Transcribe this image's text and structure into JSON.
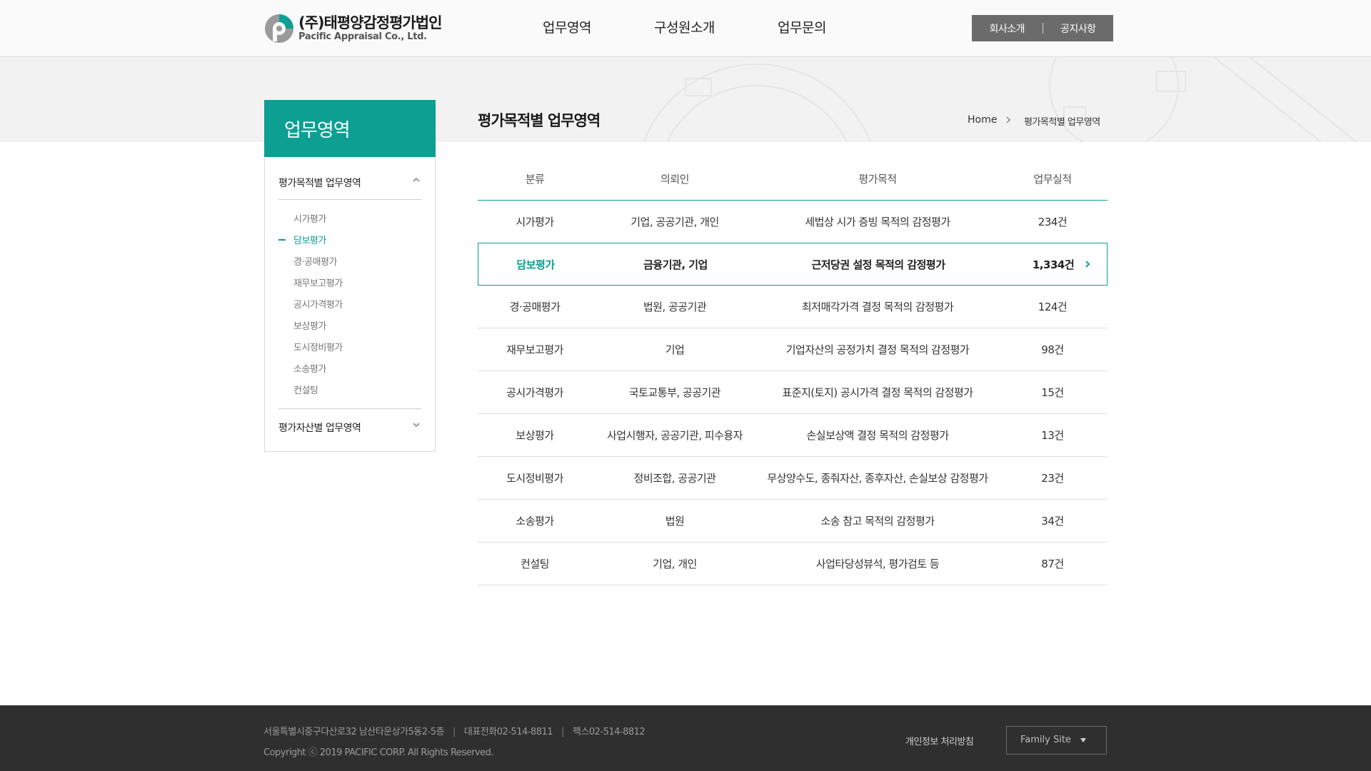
{
  "header": {
    "logo_name": "(주)태평양감정평가법인",
    "logo_name_en": "Pacific Appraisal Co., Ltd.",
    "nav": [
      "업무영역",
      "구성원소개",
      "업무문의"
    ],
    "top_links": [
      "회사소개",
      "공지사항"
    ]
  },
  "sidebar": {
    "title": "업무영역",
    "groups": [
      {
        "label": "평가목적별 업무영역",
        "expanded": true,
        "items": [
          "시가평가",
          "담보평가",
          "경·공매평가",
          "재무보고평가",
          "공시가격평가",
          "보상평가",
          "도시정비평가",
          "소송평가",
          "컨설팅"
        ],
        "active_item": "담보평가"
      },
      {
        "label": "평가자산별 업무영역",
        "expanded": false
      }
    ]
  },
  "main": {
    "title": "평가목적별 업무영역",
    "breadcrumb": {
      "home": "Home",
      "current": "평가목적별 업무영역"
    },
    "table": {
      "headers": [
        "분류",
        "의뢰인",
        "평가목적",
        "업무실적"
      ],
      "rows": [
        [
          "시가평가",
          "기업, 공공기관, 개인",
          "세법상 시가 증빙 목적의 감정평가",
          "234건"
        ],
        [
          "담보평가",
          "금융기관, 기업",
          "근저당권 설정 목적의 감정평가",
          "1,334건"
        ],
        [
          "경·공매평가",
          "법원, 공공기관",
          "최저매각가격 결정 목적의 감정평가",
          "124건"
        ],
        [
          "재무보고평가",
          "기업",
          "기업자산의 공정가치 결정 목적의 감정평가",
          "98건"
        ],
        [
          "공시가격평가",
          "국토교통부, 공공기관",
          "표준지(토지) 공시가격 결정 목적의 감정평가",
          "15건"
        ],
        [
          "보상평가",
          "사업시행자, 공공기관, 피수용자",
          "손실보상액 결정 목적의 감정평가",
          "13건"
        ],
        [
          "도시정비평가",
          "정비조합, 공공기관",
          "무상양수도, 종줘자산, 종후자산, 손실보상 감정평가",
          "23건"
        ],
        [
          "소송평가",
          "법원",
          "소송 참고 목적의 감정평가",
          "34건"
        ],
        [
          "컨설팅",
          "기업, 개인",
          "사업타당성뷰석, 평가검토 등",
          "87건"
        ]
      ],
      "selected_row": 1
    }
  },
  "footer": {
    "address": "서울특별시중구다산로32 남산타운상가5동2-5층",
    "phone": "대표전화02-514-8811",
    "fax": "팩스02-514-8812",
    "copyright": "Copyright ⓒ 2019 PACIFIC CORP. All Rights Reserved.",
    "privacy_link": "개인정보 처리방침",
    "family_site": "Family Site"
  },
  "colors": {
    "accent": "#0d9f92",
    "footer_bg": "#2f2f2f",
    "top_links_bg": "#6b6b6b"
  },
  "icons": [
    "logo-mark",
    "chevron-up-icon",
    "chevron-down-icon",
    "breadcrumb-arrow-icon",
    "row-arrow-icon",
    "caret-down-icon"
  ]
}
